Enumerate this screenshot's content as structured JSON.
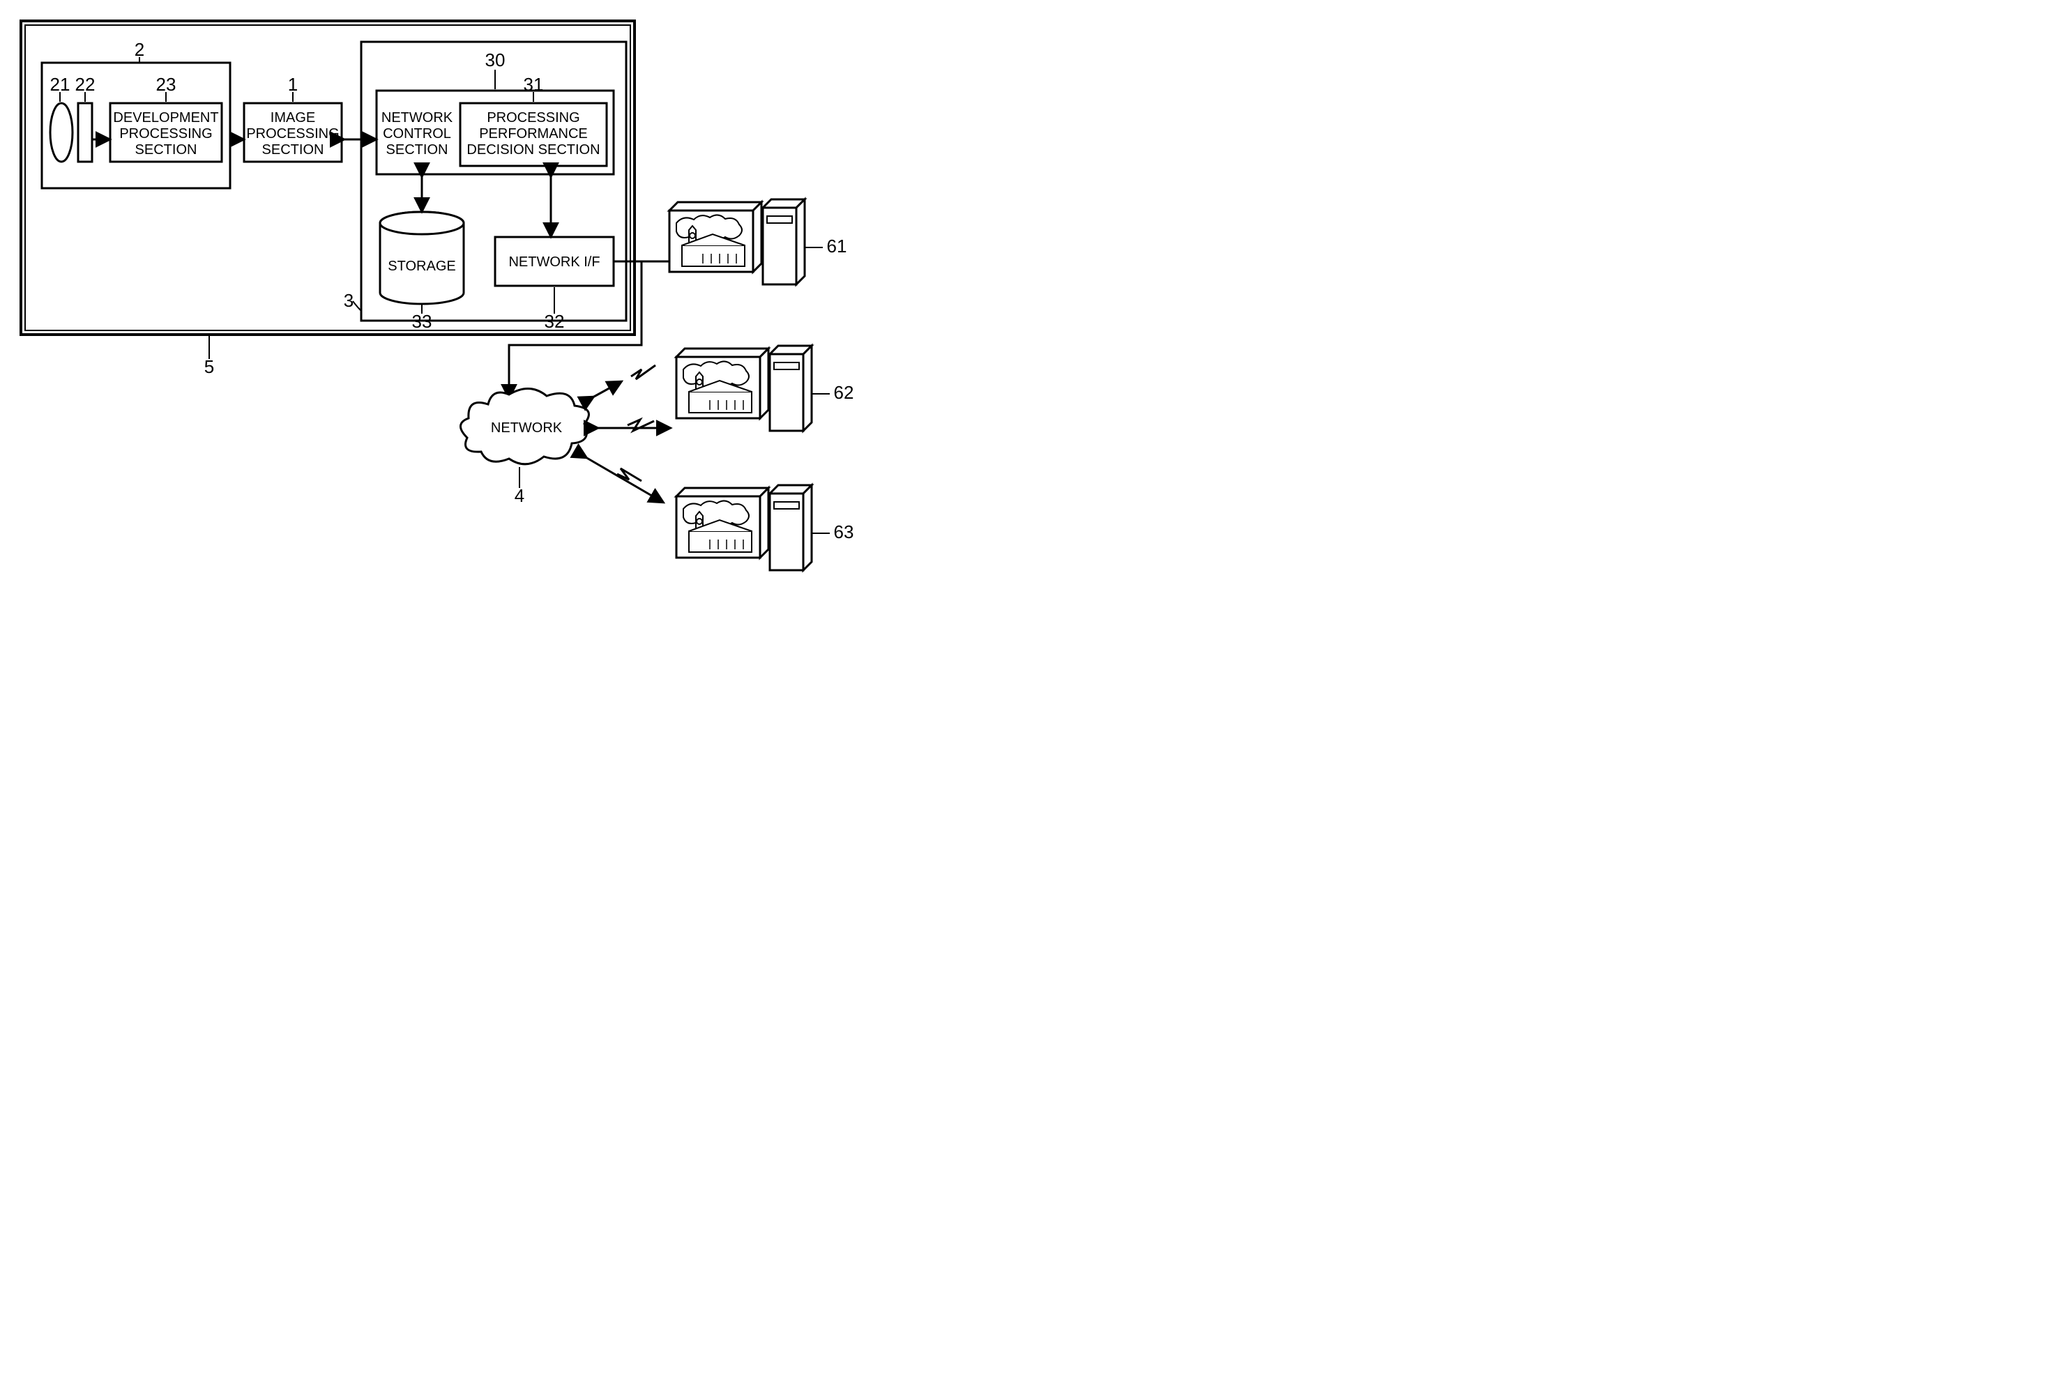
{
  "diagram": {
    "labels": {
      "n5": "5",
      "n2": "2",
      "n21": "21",
      "n22": "22",
      "n23": "23",
      "n1": "1",
      "n30": "30",
      "n31": "31",
      "n3": "3",
      "n33": "33",
      "n32": "32",
      "n4": "4",
      "n61": "61",
      "n62": "62",
      "n63": "63"
    },
    "blocks": {
      "dev": {
        "l1": "DEVELOPMENT",
        "l2": "PROCESSING",
        "l3": "SECTION"
      },
      "img": {
        "l1": "IMAGE",
        "l2": "PROCESSING",
        "l3": "SECTION"
      },
      "netctrl": {
        "l1": "NETWORK",
        "l2": "CONTROL",
        "l3": "SECTION"
      },
      "perf": {
        "l1": "PROCESSING",
        "l2": "PERFORMANCE",
        "l3": "DECISION SECTION"
      },
      "storage": "STORAGE",
      "netif": "NETWORK I/F",
      "network": "NETWORK"
    }
  }
}
